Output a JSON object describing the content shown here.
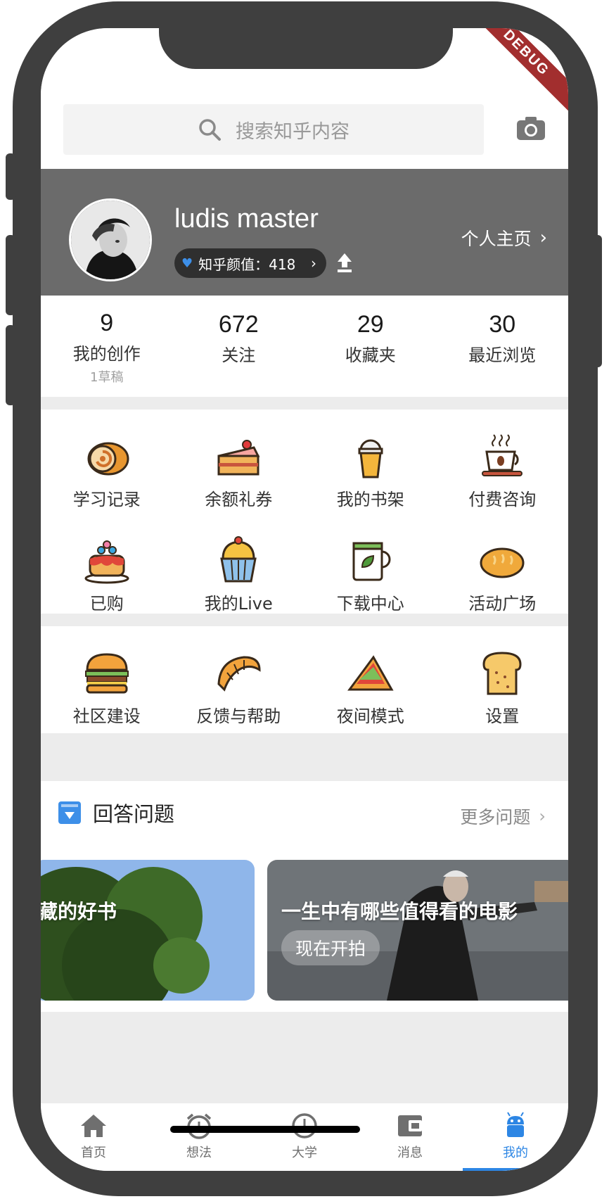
{
  "debug_banner": "DEBUG",
  "search": {
    "placeholder": "搜索知乎内容"
  },
  "profile": {
    "username": "ludis master",
    "score_label": "知乎颜值：418",
    "homepage_label": "个人主页"
  },
  "stats": [
    {
      "value": "9",
      "label": "我的创作",
      "sub": "1草稿"
    },
    {
      "value": "672",
      "label": "关注"
    },
    {
      "value": "29",
      "label": "收藏夹"
    },
    {
      "value": "30",
      "label": "最近浏览"
    }
  ],
  "grid_primary": [
    {
      "label": "学习记录",
      "icon": "swiss-roll-icon"
    },
    {
      "label": "余额礼券",
      "icon": "cake-slice-icon"
    },
    {
      "label": "我的书架",
      "icon": "smoothie-cup-icon"
    },
    {
      "label": "付费咨询",
      "icon": "coffee-cup-icon"
    },
    {
      "label": "已购",
      "icon": "pancake-stack-icon"
    },
    {
      "label": "我的Live",
      "icon": "cupcake-icon"
    },
    {
      "label": "下载中心",
      "icon": "tea-mug-icon"
    },
    {
      "label": "活动广场",
      "icon": "bread-loaf-icon"
    }
  ],
  "grid_secondary": [
    {
      "label": "社区建设",
      "icon": "burger-icon"
    },
    {
      "label": "反馈与帮助",
      "icon": "croissant-icon"
    },
    {
      "label": "夜间模式",
      "icon": "sandwich-icon"
    },
    {
      "label": "设置",
      "icon": "toast-icon"
    }
  ],
  "answer": {
    "title": "回答问题",
    "more_label": "更多问题",
    "cards": [
      {
        "title": "藏的好书"
      },
      {
        "title": "一生中有哪些值得看的电影",
        "action": "现在开拍"
      }
    ]
  },
  "nav": [
    {
      "label": "首页",
      "icon": "home-icon"
    },
    {
      "label": "想法",
      "icon": "alarm-clock-icon"
    },
    {
      "label": "大学",
      "icon": "clock-icon"
    },
    {
      "label": "消息",
      "icon": "wallet-icon"
    },
    {
      "label": "我的",
      "icon": "android-icon",
      "active": true
    }
  ],
  "colors": {
    "accent": "#2d86e4",
    "profile_band": "#6b6b6b",
    "debug": "#a22e2e"
  }
}
